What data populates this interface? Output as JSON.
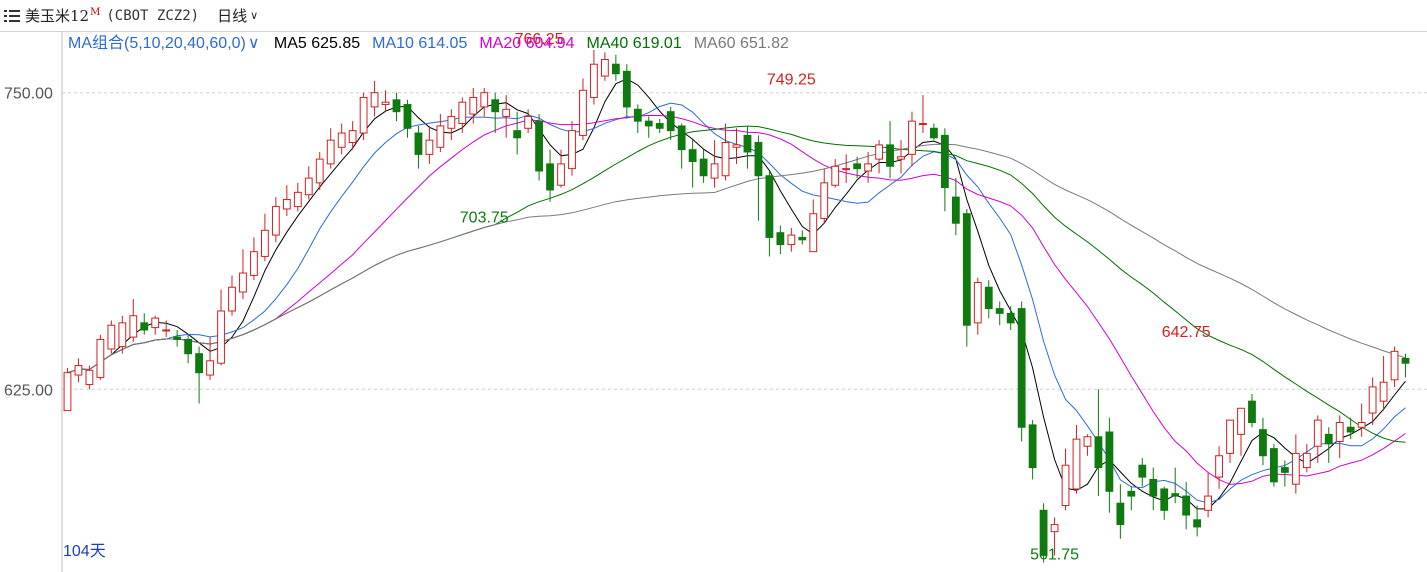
{
  "header": {
    "symbol_name": "美玉米12",
    "symbol_superscript": "M",
    "symbol_code": "(CBOT ZCZ2)",
    "period": "日线",
    "menu_icon": "menu-lines-icon",
    "chevron_icon": "chevron-down-icon"
  },
  "ma_legend": {
    "group_label": "MA组合(5,10,20,40,60,0)",
    "items": [
      {
        "name": "MA5",
        "value": "625.85",
        "color": "#000000"
      },
      {
        "name": "MA10",
        "value": "614.05",
        "color": "#2d6bd6"
      },
      {
        "name": "MA20",
        "value": "604.94",
        "color": "#d400d4"
      },
      {
        "name": "MA40",
        "value": "619.01",
        "color": "#007000"
      },
      {
        "name": "MA60",
        "value": "651.82",
        "color": "#7a7a7a"
      }
    ]
  },
  "bottom_label": "104天",
  "colors": {
    "up": "#d42020",
    "down": "#0f7a0f",
    "grid": "#cfcfcf"
  },
  "chart_data": {
    "type": "candlestick",
    "y_ticks": [
      {
        "value": 625,
        "label": "625.00"
      },
      {
        "value": 750,
        "label": "750.00"
      }
    ],
    "ylim": [
      548,
      776
    ],
    "annotations": [
      {
        "label": "766.25",
        "value": 766.25,
        "index": 43,
        "kind": "high"
      },
      {
        "label": "703.75",
        "value": 703.75,
        "index": 38,
        "kind": "low"
      },
      {
        "label": "749.25",
        "value": 749.25,
        "index": 66,
        "kind": "high"
      },
      {
        "label": "561.75",
        "value": 561.75,
        "index": 90,
        "kind": "low"
      },
      {
        "label": "642.75",
        "value": 642.75,
        "index": 102,
        "kind": "high"
      }
    ],
    "candles": [
      [
        616,
        632,
        634,
        616
      ],
      [
        631,
        635,
        638,
        628
      ],
      [
        627,
        633,
        635,
        625
      ],
      [
        630,
        646,
        648,
        629
      ],
      [
        642,
        652,
        654,
        640
      ],
      [
        643,
        653,
        656,
        640
      ],
      [
        647,
        656,
        663,
        645
      ],
      [
        653,
        650,
        657,
        648
      ],
      [
        651,
        655,
        656,
        648
      ],
      [
        650,
        650,
        654,
        647
      ],
      [
        647,
        646,
        650,
        643
      ],
      [
        646,
        640,
        648,
        636
      ],
      [
        640,
        632,
        643,
        619
      ],
      [
        631,
        637,
        647,
        629
      ],
      [
        636,
        658,
        667,
        635
      ],
      [
        658,
        668,
        673,
        656
      ],
      [
        666,
        674,
        684,
        663
      ],
      [
        673,
        683,
        689,
        671
      ],
      [
        681,
        692,
        699,
        679
      ],
      [
        690,
        702,
        706,
        687
      ],
      [
        701,
        705,
        711,
        698
      ],
      [
        702,
        708,
        712,
        700
      ],
      [
        707,
        714,
        719,
        705
      ],
      [
        712,
        722,
        725,
        709
      ],
      [
        720,
        730,
        735,
        718
      ],
      [
        727,
        733,
        737,
        724
      ],
      [
        729,
        734,
        738,
        726
      ],
      [
        733,
        748,
        750,
        730
      ],
      [
        744,
        750,
        755,
        740
      ],
      [
        745,
        746,
        751,
        742
      ],
      [
        747,
        742,
        750,
        738
      ],
      [
        745,
        735,
        747,
        731
      ],
      [
        733,
        724,
        736,
        718
      ],
      [
        724,
        730,
        736,
        720
      ],
      [
        727,
        736,
        741,
        725
      ],
      [
        735,
        740,
        743,
        730
      ],
      [
        737,
        746,
        748,
        733
      ],
      [
        741,
        748,
        752,
        737
      ],
      [
        744,
        750,
        752,
        740
      ],
      [
        747,
        742,
        750,
        733
      ],
      [
        740,
        743,
        749,
        731
      ],
      [
        734,
        731,
        742,
        724
      ],
      [
        735,
        740,
        743,
        733
      ],
      [
        738,
        717,
        741,
        713
      ],
      [
        720,
        709,
        726,
        704
      ],
      [
        711,
        720,
        726,
        710
      ],
      [
        718,
        734,
        738,
        715
      ],
      [
        732,
        751,
        756,
        730
      ],
      [
        748,
        762,
        768,
        745
      ],
      [
        757,
        764,
        767,
        755
      ],
      [
        762,
        758,
        766,
        755
      ],
      [
        759,
        744,
        762,
        739
      ],
      [
        743,
        738,
        745,
        733
      ],
      [
        738,
        736,
        740,
        731
      ],
      [
        737,
        735,
        739,
        733
      ],
      [
        742,
        734,
        744,
        730
      ],
      [
        736,
        726,
        737,
        718
      ],
      [
        726,
        721,
        730,
        710
      ],
      [
        722,
        715,
        726,
        712
      ],
      [
        714,
        720,
        730,
        710
      ],
      [
        715,
        729,
        737,
        713
      ],
      [
        727,
        728,
        735,
        720
      ],
      [
        732,
        725,
        736,
        718
      ],
      [
        729,
        715,
        732,
        696
      ],
      [
        715,
        689,
        717,
        681
      ],
      [
        691,
        686,
        694,
        682
      ],
      [
        686,
        690,
        693,
        683
      ],
      [
        689,
        688,
        692,
        686
      ],
      [
        683,
        699,
        705,
        686
      ],
      [
        697,
        712,
        718,
        695
      ],
      [
        711,
        719,
        722,
        710
      ],
      [
        718,
        718,
        724,
        712
      ],
      [
        720,
        718,
        723,
        714
      ],
      [
        717,
        720,
        725,
        712
      ],
      [
        722,
        728,
        730,
        716
      ],
      [
        728,
        719,
        738,
        714
      ],
      [
        722,
        723,
        730,
        716
      ],
      [
        724,
        738,
        742,
        719
      ],
      [
        737,
        737,
        749,
        733
      ],
      [
        735,
        731,
        737,
        730
      ],
      [
        732,
        710,
        735,
        700
      ],
      [
        706,
        695,
        714,
        690
      ],
      [
        699,
        652,
        701,
        643
      ],
      [
        653,
        670,
        672,
        648
      ],
      [
        668,
        659,
        671,
        655
      ],
      [
        659,
        657,
        662,
        652
      ],
      [
        657,
        653,
        660,
        650
      ],
      [
        659,
        609,
        662,
        603
      ],
      [
        610,
        592,
        612,
        587
      ],
      [
        574,
        555,
        577,
        552
      ],
      [
        565,
        568,
        571,
        555
      ],
      [
        576,
        593,
        600,
        574
      ],
      [
        583,
        604,
        610,
        581
      ],
      [
        601,
        605,
        606,
        597
      ],
      [
        605,
        592,
        625,
        580
      ]
    ],
    "candles_tail": [
      [
        607,
        582,
        613,
        573
      ],
      [
        577,
        568,
        585,
        562
      ],
      [
        582,
        580,
        584,
        574
      ],
      [
        593,
        588,
        596,
        584
      ],
      [
        587,
        580,
        592,
        574
      ],
      [
        583,
        574,
        584,
        570
      ],
      [
        581,
        580,
        592,
        577
      ],
      [
        580,
        572,
        586,
        566
      ],
      [
        570,
        567,
        576,
        563
      ],
      [
        574,
        580,
        590,
        571
      ],
      [
        588,
        597,
        601,
        583
      ],
      [
        598,
        612,
        612,
        594
      ],
      [
        606,
        617,
        617,
        597
      ],
      [
        620,
        611,
        623,
        609
      ],
      [
        608,
        597,
        613,
        593
      ],
      [
        600,
        586,
        602,
        584
      ],
      [
        592,
        590,
        595,
        584
      ],
      [
        585,
        598,
        606,
        581
      ],
      [
        592,
        598,
        602,
        590
      ],
      [
        601,
        612,
        614,
        594
      ],
      [
        606,
        602,
        609,
        594
      ],
      [
        603,
        611,
        614,
        596
      ],
      [
        609,
        607,
        613,
        604
      ],
      [
        609,
        611,
        619,
        605
      ],
      [
        615,
        626,
        630,
        610
      ],
      [
        620,
        628,
        639,
        616
      ],
      [
        629,
        641,
        643,
        626
      ],
      [
        638,
        636,
        640,
        630
      ]
    ]
  }
}
